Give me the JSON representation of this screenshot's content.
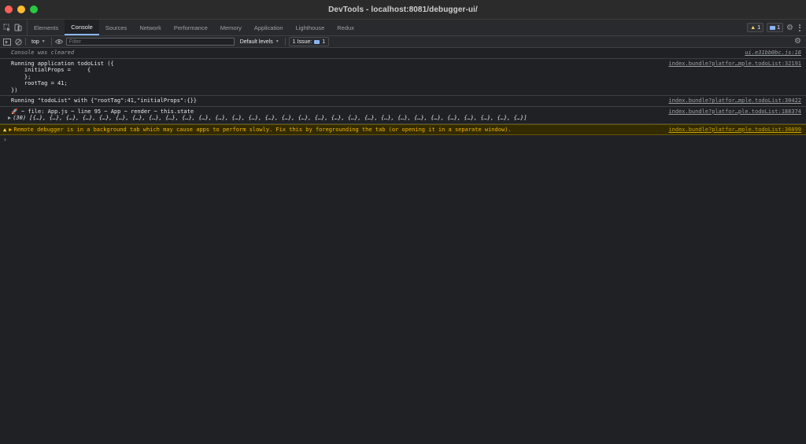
{
  "window": {
    "title": "DevTools - localhost:8081/debugger-ui/"
  },
  "tabs": [
    {
      "label": "Elements",
      "active": false
    },
    {
      "label": "Console",
      "active": true
    },
    {
      "label": "Sources",
      "active": false
    },
    {
      "label": "Network",
      "active": false
    },
    {
      "label": "Performance",
      "active": false
    },
    {
      "label": "Memory",
      "active": false
    },
    {
      "label": "Application",
      "active": false
    },
    {
      "label": "Lighthouse",
      "active": false
    },
    {
      "label": "Redux",
      "active": false
    }
  ],
  "tab_badges": {
    "warnings": "1",
    "messages": "1"
  },
  "toolbar": {
    "context": "top",
    "filter_placeholder": "Filter",
    "levels": "Default levels",
    "issues_label": "1 Issue:",
    "issues_count": "1"
  },
  "messages": [
    {
      "kind": "info",
      "text": "Console was cleared",
      "source": "ui.e31bb0bc.js:16"
    },
    {
      "kind": "log",
      "text": "Running application todoList ({\n    initialProps =     {\n    };\n    rootTag = 41;\n})",
      "source": "index.bundle?platfor…mple.todoList:32191"
    },
    {
      "kind": "log",
      "text": "Running \"todoList\" with {\"rootTag\":41,\"initialProps\":{}}",
      "source": "index.bundle?platfor…mple.todoList:30422"
    },
    {
      "kind": "log",
      "text": "🚀 ~ file: App.js ~ line 95 ~ App ~ render ~ this.state",
      "text2_prefix": "(30)",
      "text2": " [{…}, {…}, {…}, {…}, {…}, {…}, {…}, {…}, {…}, {…}, {…}, {…}, {…}, {…}, {…}, {…}, {…}, {…}, {…}, {…}, {…}, {…}, {…}, {…}, {…}, {…}, {…}, {…}, {…}, {…}]",
      "source": "index.bundle?platfor…ple.todoList:188374"
    },
    {
      "kind": "warn",
      "text": "Remote debugger is in a background tab which may cause apps to perform slowly. Fix this by foregrounding the tab (or opening it in a separate window).",
      "source": "index.bundle?platfor…mple.todoList:36099"
    }
  ],
  "prompt": "›"
}
